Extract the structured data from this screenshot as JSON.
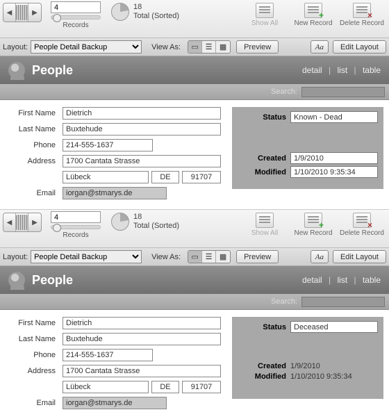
{
  "panels": [
    {
      "toolbar": {
        "record_number": "4",
        "records_label": "Records",
        "total_count": "18",
        "total_label": "Total (Sorted)",
        "show_all": "Show All",
        "new_record": "New Record",
        "delete_record": "Delete Record"
      },
      "layoutbar": {
        "layout_label": "Layout:",
        "layout_value": "People Detail Backup",
        "view_as_label": "View As:",
        "preview": "Preview",
        "aa": "Aa",
        "edit_layout": "Edit Layout"
      },
      "header": {
        "title": "People",
        "links": {
          "detail": "detail",
          "list": "list",
          "table": "table"
        }
      },
      "search": {
        "label": "Search:"
      },
      "form": {
        "labels": {
          "first_name": "First Name",
          "last_name": "Last Name",
          "phone": "Phone",
          "address": "Address",
          "email": "Email",
          "status": "Status",
          "created": "Created",
          "modified": "Modified"
        },
        "values": {
          "first_name": "Dietrich",
          "last_name": "Buxtehude",
          "phone": "214-555-1637",
          "street": "1700 Cantata Strasse",
          "city": "Lübeck",
          "state": "DE",
          "zip": "91707",
          "email": "iorgan@stmarys.de",
          "status": "Known - Dead",
          "created": "1/9/2010",
          "modified": "1/10/2010 9:35:34"
        }
      }
    },
    {
      "toolbar": {
        "record_number": "4",
        "records_label": "Records",
        "total_count": "18",
        "total_label": "Total (Sorted)",
        "show_all": "Show All",
        "new_record": "New Record",
        "delete_record": "Delete Record"
      },
      "layoutbar": {
        "layout_label": "Layout:",
        "layout_value": "People Detail Backup",
        "view_as_label": "View As:",
        "preview": "Preview",
        "aa": "Aa",
        "edit_layout": "Edit Layout"
      },
      "header": {
        "title": "People",
        "links": {
          "detail": "detail",
          "list": "list",
          "table": "table"
        }
      },
      "search": {
        "label": "Search:"
      },
      "form": {
        "labels": {
          "first_name": "First Name",
          "last_name": "Last Name",
          "phone": "Phone",
          "address": "Address",
          "email": "Email",
          "status": "Status",
          "created": "Created",
          "modified": "Modified"
        },
        "values": {
          "first_name": "Dietrich",
          "last_name": "Buxtehude",
          "phone": "214-555-1637",
          "street": "1700 Cantata Strasse",
          "city": "Lübeck",
          "state": "DE",
          "zip": "91707",
          "email": "iorgan@stmarys.de",
          "status": "Deceased",
          "created": "1/9/2010",
          "modified": "1/10/2010 9:35:34"
        }
      }
    }
  ]
}
